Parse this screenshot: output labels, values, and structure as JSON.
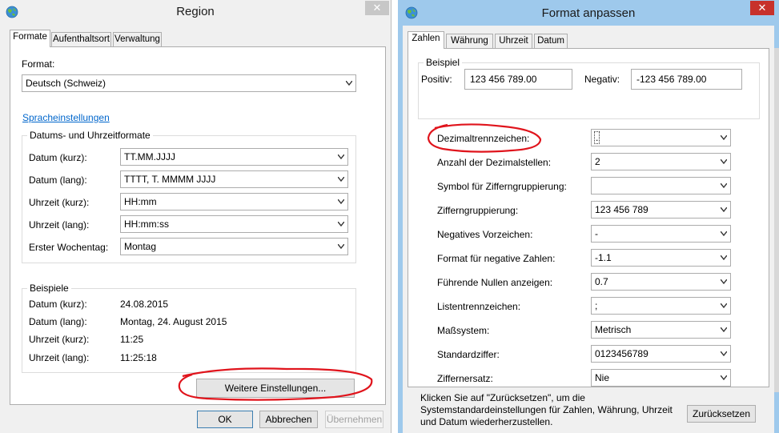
{
  "left": {
    "title": "Region",
    "close_glyph": "✕",
    "tabs": [
      {
        "label": "Formate"
      },
      {
        "label": "Aufenthaltsort"
      },
      {
        "label": "Verwaltung"
      }
    ],
    "format_label": "Format:",
    "format_value": "Deutsch (Schweiz)",
    "language_link": "Spracheinstellungen",
    "date_group_title": "Datums- und Uhrzeitformate",
    "date_rows": [
      {
        "label": "Datum (kurz):",
        "value": "TT.MM.JJJJ"
      },
      {
        "label": "Datum (lang):",
        "value": "TTTT, T. MMMM JJJJ"
      },
      {
        "label": "Uhrzeit (kurz):",
        "value": "HH:mm"
      },
      {
        "label": "Uhrzeit (lang):",
        "value": "HH:mm:ss"
      },
      {
        "label": "Erster Wochentag:",
        "value": "Montag"
      }
    ],
    "examples_title": "Beispiele",
    "examples": [
      {
        "label": "Datum (kurz):",
        "value": "24.08.2015"
      },
      {
        "label": "Datum (lang):",
        "value": "Montag, 24. August 2015"
      },
      {
        "label": "Uhrzeit (kurz):",
        "value": "11:25"
      },
      {
        "label": "Uhrzeit (lang):",
        "value": "11:25:18"
      }
    ],
    "more_settings_button": "Weitere Einstellungen...",
    "ok_button": "OK",
    "cancel_button": "Abbrechen",
    "apply_button": "Übernehmen"
  },
  "right": {
    "title": "Format anpassen",
    "close_glyph": "✕",
    "tabs": [
      {
        "label": "Zahlen"
      },
      {
        "label": "Währung"
      },
      {
        "label": "Uhrzeit"
      },
      {
        "label": "Datum"
      }
    ],
    "example_title": "Beispiel",
    "positive_label": "Positiv:",
    "positive_value": "123 456 789.00",
    "negative_label": "Negativ:",
    "negative_value": "-123 456 789.00",
    "settings": [
      {
        "label": "Dezimaltrennzeichen:",
        "value": "."
      },
      {
        "label": "Anzahl der Dezimalstellen:",
        "value": "2"
      },
      {
        "label": "Symbol für Zifferngruppierung:",
        "value": ""
      },
      {
        "label": "Zifferngruppierung:",
        "value": "123 456 789"
      },
      {
        "label": "Negatives Vorzeichen:",
        "value": "-"
      },
      {
        "label": "Format für negative Zahlen:",
        "value": "-1.1"
      },
      {
        "label": "Führende Nullen anzeigen:",
        "value": "0.7"
      },
      {
        "label": "Listentrennzeichen:",
        "value": ";"
      },
      {
        "label": "Maßsystem:",
        "value": "Metrisch"
      },
      {
        "label": "Standardziffer:",
        "value": "0123456789"
      },
      {
        "label": "Ziffernersatz:",
        "value": "Nie"
      }
    ],
    "reset_text": "Klicken Sie auf \"Zurücksetzen\", um die Systemstandardeinstellungen für Zahlen, Währung, Uhrzeit und Datum wiederherzustellen.",
    "reset_button": "Zurücksetzen"
  },
  "colors": {
    "left_title_bg": "#f0f0f0",
    "right_title_bg": "#9ec9ec",
    "close_red": "#c7312b",
    "close_gray": "#c7c7c7",
    "annotation_red": "#e0141c"
  }
}
